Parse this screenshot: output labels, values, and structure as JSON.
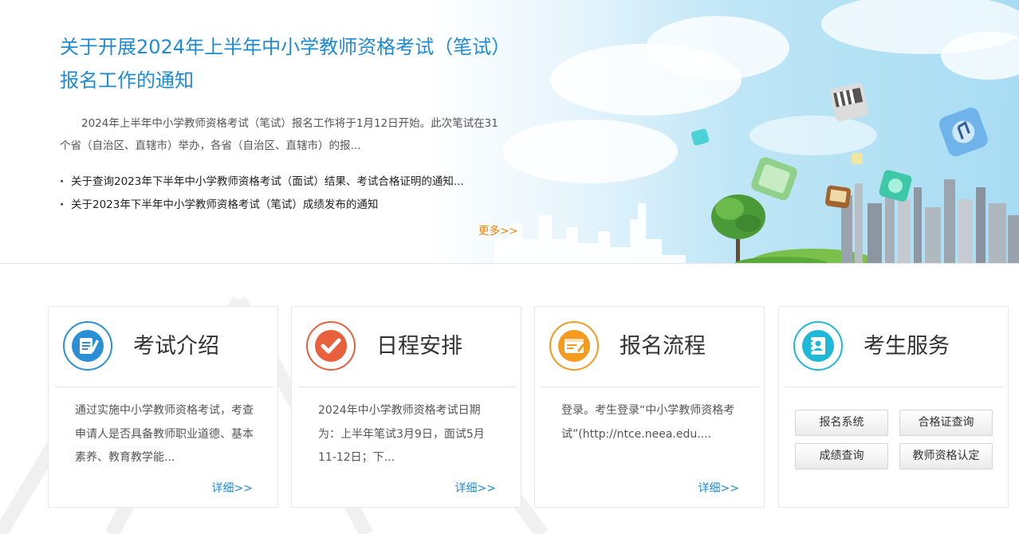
{
  "hero": {
    "title": "关于开展2024年上半年中小学教师资格考试（笔试）报名工作的通知",
    "summary": "2024年上半年中小学教师资格考试（笔试）报名工作将于1月12日开始。此次笔试在31个省（自治区、直辖市）举办，各省（自治区、直辖市）的报...",
    "news": [
      {
        "bullet": "·",
        "text": "关于查询2023年下半年中小学教师资格考试（面试）结果、考试合格证明的通知..."
      },
      {
        "bullet": "·",
        "text": "关于2023年下半年中小学教师资格考试（笔试）成绩发布的通知"
      }
    ],
    "more_label": "更多>>"
  },
  "cards": [
    {
      "title": "考试介绍",
      "icon": "document-edit-icon",
      "accent": "#2b8fd6",
      "desc": "通过实施中小学教师资格考试，考查申请人是否具备教师职业道德、基本素养、教育教学能...",
      "detail_label": "详细>>"
    },
    {
      "title": "日程安排",
      "icon": "checkmark-icon",
      "accent": "#e8603c",
      "desc": "2024年中小学教师资格考试日期为：上半年笔试3月9日，面试5月11-12日；下...",
      "detail_label": "详细>>"
    },
    {
      "title": "报名流程",
      "icon": "registration-form-icon",
      "accent": "#f39a1f",
      "desc": "登录。考生登录“中小学教师资格考试”(http://ntce.neea.edu....",
      "detail_label": "详细>>"
    },
    {
      "title": "考生服务",
      "icon": "contact-book-icon",
      "accent": "#1fb8d6",
      "buttons": [
        "报名系统",
        "合格证查询",
        "成绩查询",
        "教师资格认定"
      ]
    }
  ],
  "colors": {
    "title_blue": "#1e8bd6",
    "more_orange": "#f08300",
    "detail_blue": "#1e8bd6"
  }
}
